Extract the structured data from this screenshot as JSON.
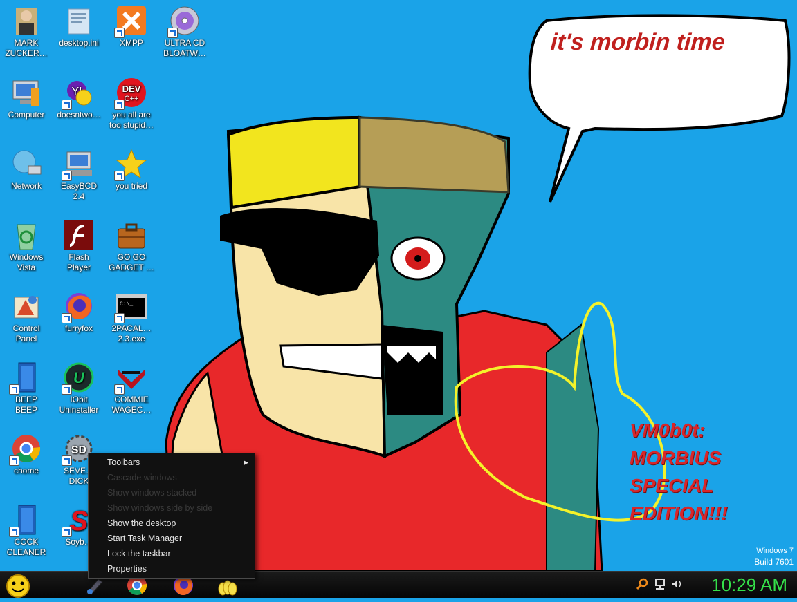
{
  "desktop": {
    "icons": [
      {
        "label": "MARK\nZUCKER…",
        "icon": "portrait-icon"
      },
      {
        "label": "desktop.ini",
        "icon": "config-file-icon"
      },
      {
        "label": "XMPP",
        "icon": "xampp-icon"
      },
      {
        "label": "ULTRA CD\nBLOATW…",
        "icon": "cd-icon"
      },
      {
        "label": "Computer",
        "icon": "computer-icon"
      },
      {
        "label": "doesntwo…",
        "icon": "yahoo-messenger-icon"
      },
      {
        "label": "you all are\ntoo stupid…",
        "icon": "dev-cpp-icon"
      },
      {
        "label": "Network",
        "icon": "network-icon"
      },
      {
        "label": "EasyBCD\n2.4",
        "icon": "easybcd-icon"
      },
      {
        "label": "you tried",
        "icon": "star-icon"
      },
      {
        "label": "Windows\nVista",
        "icon": "recycle-bin-icon"
      },
      {
        "label": "Flash\nPlayer",
        "icon": "flash-icon"
      },
      {
        "label": "GO GO\nGADGET …",
        "icon": "briefcase-icon"
      },
      {
        "label": "Control\nPanel",
        "icon": "control-panel-icon"
      },
      {
        "label": "furryfox",
        "icon": "firefox-icon"
      },
      {
        "label": "2PACAL…\n2.3.exe",
        "icon": "console-icon"
      },
      {
        "label": "BEEP\nBEEP",
        "icon": "blue-book-icon"
      },
      {
        "label": "IObit\nUninstaller",
        "icon": "iobit-icon"
      },
      {
        "label": "COMMIE\nWAGEC…",
        "icon": "commie-icon"
      },
      {
        "label": "chome",
        "icon": "chrome-icon"
      },
      {
        "label": "SEVE…\nDICK",
        "icon": "gear-sd-icon"
      },
      {
        "label": "COCK\nCLEANER",
        "icon": "blue-book-icon"
      },
      {
        "label": "Soyb…",
        "icon": "red-s-icon"
      }
    ]
  },
  "wallpaper": {
    "speech_text": "it's morbin time",
    "edition_lines": [
      "VM0b0t:",
      "MORBIUS",
      "SPECIAL",
      "EDITION!!!"
    ]
  },
  "context_menu": {
    "items": [
      {
        "label": "Toolbars",
        "enabled": true,
        "submenu": true
      },
      {
        "label": "Cascade windows",
        "enabled": false
      },
      {
        "label": "Show windows stacked",
        "enabled": false
      },
      {
        "label": "Show windows side by side",
        "enabled": false
      },
      {
        "label": "Show the desktop",
        "enabled": true
      },
      {
        "label": "Start Task Manager",
        "enabled": true
      },
      {
        "label": "Lock the taskbar",
        "enabled": true
      },
      {
        "label": "Properties",
        "enabled": true
      }
    ]
  },
  "taskbar": {
    "start_icon": "smiley-start-icon",
    "pinned": [
      "paint-icon",
      "chrome-icon",
      "firefox-icon",
      "folder-icon"
    ],
    "tray": [
      "search-icon",
      "network-tray-icon",
      "volume-icon"
    ],
    "clock": "10:29 AM"
  },
  "watermark": {
    "line1": "Windows 7",
    "line2": "Build 7601"
  },
  "colors": {
    "desktop_bg": "#1aa3e8",
    "clock": "#35e04a",
    "speech_text": "#c0201e",
    "edition_text": "#d8262a"
  }
}
